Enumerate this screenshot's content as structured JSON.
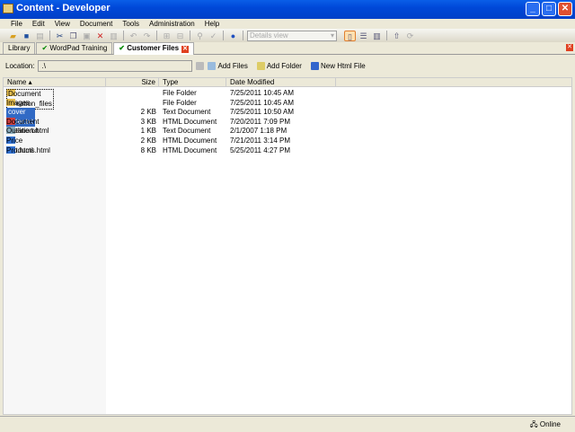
{
  "window": {
    "title": "Content - Developer"
  },
  "menu": [
    "File",
    "Edit",
    "View",
    "Document",
    "Tools",
    "Administration",
    "Help"
  ],
  "toolbar": {
    "view_select": "Details view"
  },
  "tabs": [
    {
      "label": "Library"
    },
    {
      "label": "WordPad Training"
    },
    {
      "label": "Customer Files",
      "active": true
    }
  ],
  "location": {
    "label": "Location:",
    "value": ".\\",
    "actions": [
      "Add Files",
      "Add Folder",
      "New Html File"
    ]
  },
  "columns": [
    "Name",
    "Size",
    "Type",
    "Date Modified"
  ],
  "files": [
    {
      "name": "Document Creation_files",
      "size": "",
      "type": "File Folder",
      "date": "7/25/2011 10:45 AM",
      "icon": "folder"
    },
    {
      "name": "Images and Logos",
      "size": "",
      "type": "File Folder",
      "date": "7/25/2011 10:45 AM",
      "icon": "folder"
    },
    {
      "name": "cover letter.txt",
      "size": "2 KB",
      "type": "Text Document",
      "date": "7/25/2011 10:50 AM",
      "icon": "text",
      "selected": true
    },
    {
      "name": "Document Creation.html",
      "size": "3 KB",
      "type": "HTML Document",
      "date": "7/20/2011 7:09 PM",
      "icon": "html"
    },
    {
      "name": "Outline.txt",
      "size": "1 KB",
      "type": "Text Document",
      "date": "2/1/2007 1:18 PM",
      "icon": "text"
    },
    {
      "name": "Price List.html",
      "size": "2 KB",
      "type": "HTML Document",
      "date": "7/21/2011 3:14 PM",
      "icon": "ie"
    },
    {
      "name": "Products.html",
      "size": "8 KB",
      "type": "HTML Document",
      "date": "5/25/2011 4:27 PM",
      "icon": "ie"
    }
  ],
  "status": {
    "text": "Online"
  },
  "colors": {
    "titlebar": "#0050d8",
    "selection": "#316ac5"
  }
}
